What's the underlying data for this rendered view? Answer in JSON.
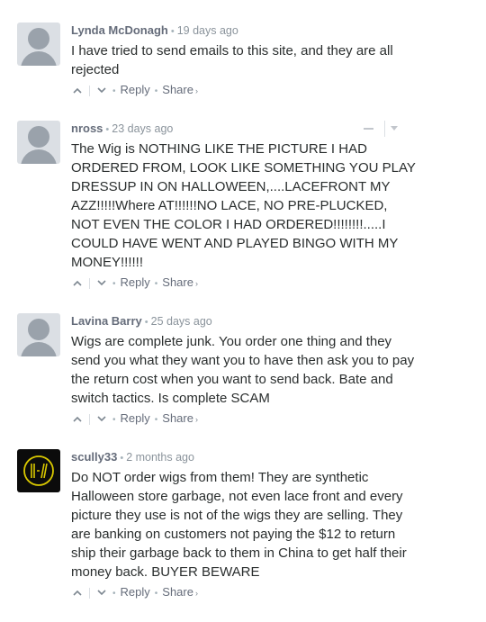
{
  "actions": {
    "reply_label": "Reply",
    "share_label": "Share",
    "share_chevron": "›",
    "upvote_icon": "chevron-up-icon",
    "downvote_icon": "chevron-down-icon"
  },
  "comments": [
    {
      "author": "Lynda McDonagh",
      "time": "19 days ago",
      "avatar": "default-avatar",
      "text": "I have tried to send emails to this site, and they are all rejected"
    },
    {
      "author": "nross",
      "time": "23 days ago",
      "avatar": "default-avatar",
      "text": "The Wig is NOTHING LIKE THE PICTURE I HAD ORDERED FROM, LOOK LIKE SOMETHING YOU PLAY DRESSUP IN ON HALLOWEEN,....LACEFRONT MY AZZ!!!!!Where AT!!!!!!NO LACE, NO PRE-PLUCKED, NOT EVEN THE COLOR I HAD ORDERED!!!!!!!!.....I COULD HAVE WENT AND PLAYED BINGO WITH MY MONEY!!!!!!"
    },
    {
      "author": "Lavina Barry",
      "time": "25 days ago",
      "avatar": "default-avatar",
      "text": "Wigs are complete junk. You order one thing and they send you what they want you to have then ask you to pay the return cost when you want to send back. Bate and switch tactics. Is complete SCAM"
    },
    {
      "author": "scully33",
      "time": "2 months ago",
      "avatar": "band-logo-avatar",
      "text": "Do NOT order wigs from them! They are synthetic Halloween store garbage, not even lace front and every picture they use is not of the wigs they are selling. They are banking on customers not paying the $12 to return ship their garbage back to them in China to get half their money back. BUYER BEWARE"
    }
  ],
  "colors": {
    "author": "#656c7a",
    "meta": "#8b949c",
    "body": "#2a2e2e",
    "avatar_bg": "#dbdfe4",
    "avatar_fg": "#9aa2ab",
    "logo_ring": "#d9c800"
  }
}
